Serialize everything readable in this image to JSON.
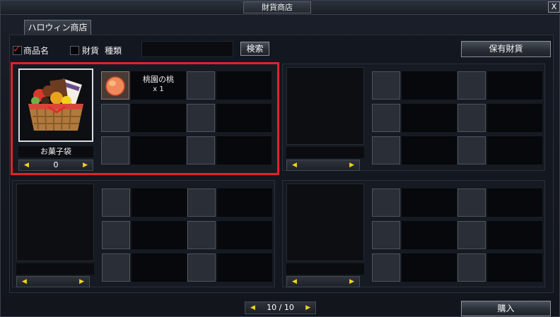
{
  "window": {
    "title": "財貨商店",
    "close_glyph": "X"
  },
  "tabs": [
    {
      "label": "ハロウィン商店"
    }
  ],
  "filters": {
    "product_name_label": "商品名",
    "product_name_checked": true,
    "currency_label": "財貨",
    "kind_label": "種類",
    "currency_checked": false,
    "search_value": "",
    "search_button": "検索",
    "owned_currency_button": "保有財貨"
  },
  "products": [
    {
      "name": "お菓子袋",
      "quantity": "0",
      "icon": "candy-basket-icon",
      "selected": true,
      "materials": [
        {
          "name": "桃園の桃",
          "count": "x 1",
          "icon": "peach-icon"
        },
        {
          "name": "",
          "count": ""
        },
        {
          "name": "",
          "count": ""
        },
        {
          "name": "",
          "count": ""
        },
        {
          "name": "",
          "count": ""
        },
        {
          "name": "",
          "count": ""
        }
      ]
    },
    {
      "name": "",
      "quantity": "",
      "selected": false,
      "materials": [
        {},
        {},
        {},
        {},
        {},
        {}
      ]
    },
    {
      "name": "",
      "quantity": "",
      "selected": false,
      "materials": [
        {},
        {},
        {},
        {},
        {},
        {}
      ]
    },
    {
      "name": "",
      "quantity": "",
      "selected": false,
      "materials": [
        {},
        {},
        {},
        {},
        {},
        {}
      ]
    }
  ],
  "pagination": {
    "text": "10 / 10"
  },
  "buy_button": "購入",
  "colors": {
    "selection": "#e4212b",
    "arrow": "#f2d21c",
    "checkmark": "#e0202a"
  }
}
